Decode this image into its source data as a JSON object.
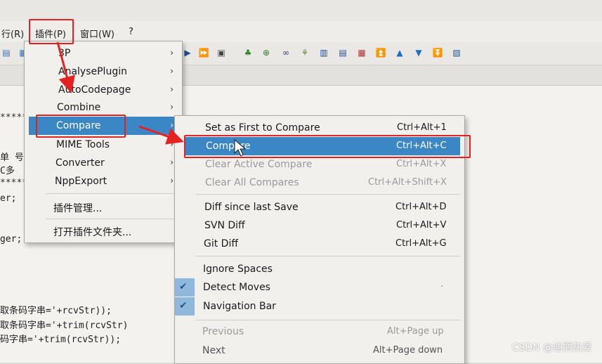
{
  "menubar": {
    "run_label": "行(R)",
    "plugins_label": "插件(P)",
    "window_label": "窗口(W)",
    "help_label": "?"
  },
  "editor_lines": [
    "单 号",
    "C多",
    "er;",
    "ger;",
    "取条码字串='+rcvStr));",
    "取条码字串='+trim(rcvStr)",
    "码字串='+trim(rcvStr));"
  ],
  "plugins_menu": {
    "items": [
      {
        "label": "3P",
        "submenu": true
      },
      {
        "label": "AnalysePlugin",
        "submenu": true
      },
      {
        "label": "AutoCodepage",
        "submenu": true
      },
      {
        "label": "Combine",
        "submenu": true
      },
      {
        "label": "Compare",
        "submenu": true
      },
      {
        "label": "MIME Tools",
        "submenu": true
      },
      {
        "label": "Converter",
        "submenu": true
      },
      {
        "label": "NppExport",
        "submenu": true
      },
      {
        "label": "插件管理..."
      },
      {
        "label": "打开插件文件夹..."
      }
    ],
    "arrow": "›"
  },
  "compare_menu": {
    "items": [
      {
        "label": "Set as First to Compare",
        "shortcut": "Ctrl+Alt+1"
      },
      {
        "label": "Compare",
        "shortcut": "Ctrl+Alt+C"
      },
      {
        "label": "Clear Active Compare",
        "shortcut": "Ctrl+Alt+X"
      },
      {
        "label": "Clear All Compares",
        "shortcut": "Ctrl+Alt+Shift+X"
      },
      {
        "label": "Diff since last Save",
        "shortcut": "Ctrl+Alt+D"
      },
      {
        "label": "SVN Diff",
        "shortcut": "Ctrl+Alt+V"
      },
      {
        "label": "Git Diff",
        "shortcut": "Ctrl+Alt+G"
      },
      {
        "label": "Ignore Spaces",
        "shortcut": ""
      },
      {
        "label": "Detect Moves",
        "shortcut": "·"
      },
      {
        "label": "Navigation Bar",
        "shortcut": ""
      },
      {
        "label": "Previous",
        "shortcut": "Alt+Page up"
      },
      {
        "label": "Next",
        "shortcut": "Alt+Page down"
      }
    ],
    "check_glyph": "✔"
  },
  "watermark": "CSDN @迪丽热爱",
  "colors": {
    "highlight": "#3b87c6",
    "annotation_red": "#e52222"
  }
}
